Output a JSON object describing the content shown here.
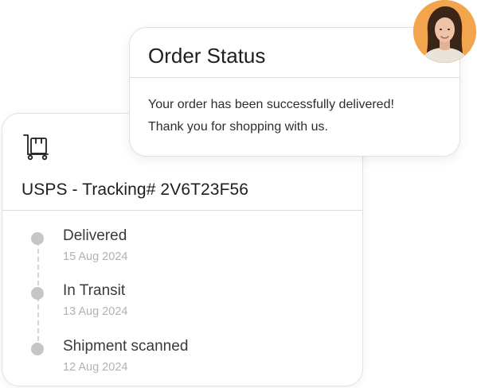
{
  "order_status": {
    "title": "Order Status",
    "message_line1": "Your order has been successfully delivered!",
    "message_line2": "Thank you for shopping with us."
  },
  "tracking": {
    "icon": "package-cart-icon",
    "title": "USPS - Tracking# 2V6T23F56",
    "events": [
      {
        "label": "Delivered",
        "date": "15 Aug 2024"
      },
      {
        "label": "In Transit",
        "date": "13 Aug 2024"
      },
      {
        "label": "Shipment scanned",
        "date": "12 Aug 2024"
      }
    ]
  },
  "avatar": {
    "icon": "user-avatar",
    "background_color": "#F2A54C"
  }
}
